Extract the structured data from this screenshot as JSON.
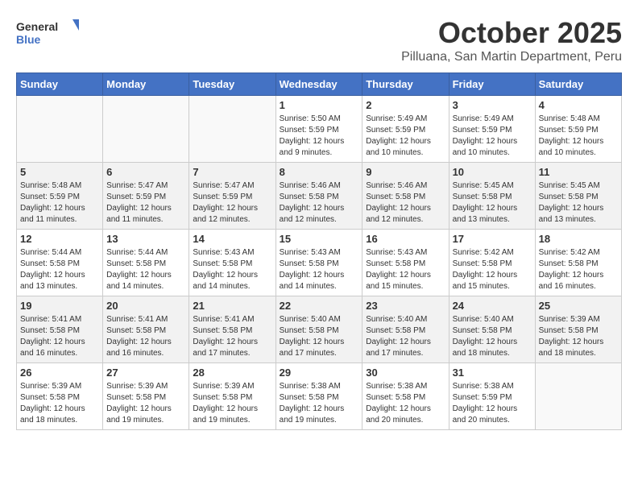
{
  "header": {
    "logo_general": "General",
    "logo_blue": "Blue",
    "month_title": "October 2025",
    "location": "Pilluana, San Martin Department, Peru"
  },
  "weekdays": [
    "Sunday",
    "Monday",
    "Tuesday",
    "Wednesday",
    "Thursday",
    "Friday",
    "Saturday"
  ],
  "weeks": [
    [
      {
        "day": "",
        "info": ""
      },
      {
        "day": "",
        "info": ""
      },
      {
        "day": "",
        "info": ""
      },
      {
        "day": "1",
        "info": "Sunrise: 5:50 AM\nSunset: 5:59 PM\nDaylight: 12 hours\nand 9 minutes."
      },
      {
        "day": "2",
        "info": "Sunrise: 5:49 AM\nSunset: 5:59 PM\nDaylight: 12 hours\nand 10 minutes."
      },
      {
        "day": "3",
        "info": "Sunrise: 5:49 AM\nSunset: 5:59 PM\nDaylight: 12 hours\nand 10 minutes."
      },
      {
        "day": "4",
        "info": "Sunrise: 5:48 AM\nSunset: 5:59 PM\nDaylight: 12 hours\nand 10 minutes."
      }
    ],
    [
      {
        "day": "5",
        "info": "Sunrise: 5:48 AM\nSunset: 5:59 PM\nDaylight: 12 hours\nand 11 minutes."
      },
      {
        "day": "6",
        "info": "Sunrise: 5:47 AM\nSunset: 5:59 PM\nDaylight: 12 hours\nand 11 minutes."
      },
      {
        "day": "7",
        "info": "Sunrise: 5:47 AM\nSunset: 5:59 PM\nDaylight: 12 hours\nand 12 minutes."
      },
      {
        "day": "8",
        "info": "Sunrise: 5:46 AM\nSunset: 5:58 PM\nDaylight: 12 hours\nand 12 minutes."
      },
      {
        "day": "9",
        "info": "Sunrise: 5:46 AM\nSunset: 5:58 PM\nDaylight: 12 hours\nand 12 minutes."
      },
      {
        "day": "10",
        "info": "Sunrise: 5:45 AM\nSunset: 5:58 PM\nDaylight: 12 hours\nand 13 minutes."
      },
      {
        "day": "11",
        "info": "Sunrise: 5:45 AM\nSunset: 5:58 PM\nDaylight: 12 hours\nand 13 minutes."
      }
    ],
    [
      {
        "day": "12",
        "info": "Sunrise: 5:44 AM\nSunset: 5:58 PM\nDaylight: 12 hours\nand 13 minutes."
      },
      {
        "day": "13",
        "info": "Sunrise: 5:44 AM\nSunset: 5:58 PM\nDaylight: 12 hours\nand 14 minutes."
      },
      {
        "day": "14",
        "info": "Sunrise: 5:43 AM\nSunset: 5:58 PM\nDaylight: 12 hours\nand 14 minutes."
      },
      {
        "day": "15",
        "info": "Sunrise: 5:43 AM\nSunset: 5:58 PM\nDaylight: 12 hours\nand 14 minutes."
      },
      {
        "day": "16",
        "info": "Sunrise: 5:43 AM\nSunset: 5:58 PM\nDaylight: 12 hours\nand 15 minutes."
      },
      {
        "day": "17",
        "info": "Sunrise: 5:42 AM\nSunset: 5:58 PM\nDaylight: 12 hours\nand 15 minutes."
      },
      {
        "day": "18",
        "info": "Sunrise: 5:42 AM\nSunset: 5:58 PM\nDaylight: 12 hours\nand 16 minutes."
      }
    ],
    [
      {
        "day": "19",
        "info": "Sunrise: 5:41 AM\nSunset: 5:58 PM\nDaylight: 12 hours\nand 16 minutes."
      },
      {
        "day": "20",
        "info": "Sunrise: 5:41 AM\nSunset: 5:58 PM\nDaylight: 12 hours\nand 16 minutes."
      },
      {
        "day": "21",
        "info": "Sunrise: 5:41 AM\nSunset: 5:58 PM\nDaylight: 12 hours\nand 17 minutes."
      },
      {
        "day": "22",
        "info": "Sunrise: 5:40 AM\nSunset: 5:58 PM\nDaylight: 12 hours\nand 17 minutes."
      },
      {
        "day": "23",
        "info": "Sunrise: 5:40 AM\nSunset: 5:58 PM\nDaylight: 12 hours\nand 17 minutes."
      },
      {
        "day": "24",
        "info": "Sunrise: 5:40 AM\nSunset: 5:58 PM\nDaylight: 12 hours\nand 18 minutes."
      },
      {
        "day": "25",
        "info": "Sunrise: 5:39 AM\nSunset: 5:58 PM\nDaylight: 12 hours\nand 18 minutes."
      }
    ],
    [
      {
        "day": "26",
        "info": "Sunrise: 5:39 AM\nSunset: 5:58 PM\nDaylight: 12 hours\nand 18 minutes."
      },
      {
        "day": "27",
        "info": "Sunrise: 5:39 AM\nSunset: 5:58 PM\nDaylight: 12 hours\nand 19 minutes."
      },
      {
        "day": "28",
        "info": "Sunrise: 5:39 AM\nSunset: 5:58 PM\nDaylight: 12 hours\nand 19 minutes."
      },
      {
        "day": "29",
        "info": "Sunrise: 5:38 AM\nSunset: 5:58 PM\nDaylight: 12 hours\nand 19 minutes."
      },
      {
        "day": "30",
        "info": "Sunrise: 5:38 AM\nSunset: 5:58 PM\nDaylight: 12 hours\nand 20 minutes."
      },
      {
        "day": "31",
        "info": "Sunrise: 5:38 AM\nSunset: 5:59 PM\nDaylight: 12 hours\nand 20 minutes."
      },
      {
        "day": "",
        "info": ""
      }
    ]
  ]
}
